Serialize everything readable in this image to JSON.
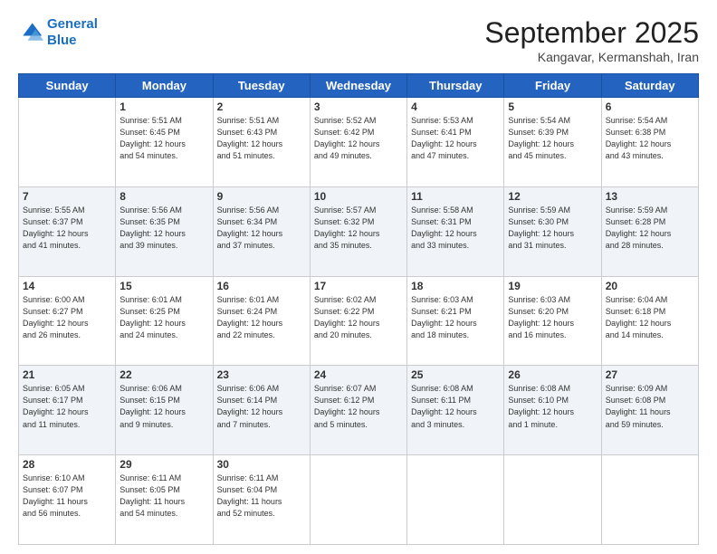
{
  "logo": {
    "line1": "General",
    "line2": "Blue"
  },
  "title": "September 2025",
  "location": "Kangavar, Kermanshah, Iran",
  "days_of_week": [
    "Sunday",
    "Monday",
    "Tuesday",
    "Wednesday",
    "Thursday",
    "Friday",
    "Saturday"
  ],
  "rows": [
    [
      {
        "day": "",
        "text": ""
      },
      {
        "day": "1",
        "text": "Sunrise: 5:51 AM\nSunset: 6:45 PM\nDaylight: 12 hours\nand 54 minutes."
      },
      {
        "day": "2",
        "text": "Sunrise: 5:51 AM\nSunset: 6:43 PM\nDaylight: 12 hours\nand 51 minutes."
      },
      {
        "day": "3",
        "text": "Sunrise: 5:52 AM\nSunset: 6:42 PM\nDaylight: 12 hours\nand 49 minutes."
      },
      {
        "day": "4",
        "text": "Sunrise: 5:53 AM\nSunset: 6:41 PM\nDaylight: 12 hours\nand 47 minutes."
      },
      {
        "day": "5",
        "text": "Sunrise: 5:54 AM\nSunset: 6:39 PM\nDaylight: 12 hours\nand 45 minutes."
      },
      {
        "day": "6",
        "text": "Sunrise: 5:54 AM\nSunset: 6:38 PM\nDaylight: 12 hours\nand 43 minutes."
      }
    ],
    [
      {
        "day": "7",
        "text": "Sunrise: 5:55 AM\nSunset: 6:37 PM\nDaylight: 12 hours\nand 41 minutes."
      },
      {
        "day": "8",
        "text": "Sunrise: 5:56 AM\nSunset: 6:35 PM\nDaylight: 12 hours\nand 39 minutes."
      },
      {
        "day": "9",
        "text": "Sunrise: 5:56 AM\nSunset: 6:34 PM\nDaylight: 12 hours\nand 37 minutes."
      },
      {
        "day": "10",
        "text": "Sunrise: 5:57 AM\nSunset: 6:32 PM\nDaylight: 12 hours\nand 35 minutes."
      },
      {
        "day": "11",
        "text": "Sunrise: 5:58 AM\nSunset: 6:31 PM\nDaylight: 12 hours\nand 33 minutes."
      },
      {
        "day": "12",
        "text": "Sunrise: 5:59 AM\nSunset: 6:30 PM\nDaylight: 12 hours\nand 31 minutes."
      },
      {
        "day": "13",
        "text": "Sunrise: 5:59 AM\nSunset: 6:28 PM\nDaylight: 12 hours\nand 28 minutes."
      }
    ],
    [
      {
        "day": "14",
        "text": "Sunrise: 6:00 AM\nSunset: 6:27 PM\nDaylight: 12 hours\nand 26 minutes."
      },
      {
        "day": "15",
        "text": "Sunrise: 6:01 AM\nSunset: 6:25 PM\nDaylight: 12 hours\nand 24 minutes."
      },
      {
        "day": "16",
        "text": "Sunrise: 6:01 AM\nSunset: 6:24 PM\nDaylight: 12 hours\nand 22 minutes."
      },
      {
        "day": "17",
        "text": "Sunrise: 6:02 AM\nSunset: 6:22 PM\nDaylight: 12 hours\nand 20 minutes."
      },
      {
        "day": "18",
        "text": "Sunrise: 6:03 AM\nSunset: 6:21 PM\nDaylight: 12 hours\nand 18 minutes."
      },
      {
        "day": "19",
        "text": "Sunrise: 6:03 AM\nSunset: 6:20 PM\nDaylight: 12 hours\nand 16 minutes."
      },
      {
        "day": "20",
        "text": "Sunrise: 6:04 AM\nSunset: 6:18 PM\nDaylight: 12 hours\nand 14 minutes."
      }
    ],
    [
      {
        "day": "21",
        "text": "Sunrise: 6:05 AM\nSunset: 6:17 PM\nDaylight: 12 hours\nand 11 minutes."
      },
      {
        "day": "22",
        "text": "Sunrise: 6:06 AM\nSunset: 6:15 PM\nDaylight: 12 hours\nand 9 minutes."
      },
      {
        "day": "23",
        "text": "Sunrise: 6:06 AM\nSunset: 6:14 PM\nDaylight: 12 hours\nand 7 minutes."
      },
      {
        "day": "24",
        "text": "Sunrise: 6:07 AM\nSunset: 6:12 PM\nDaylight: 12 hours\nand 5 minutes."
      },
      {
        "day": "25",
        "text": "Sunrise: 6:08 AM\nSunset: 6:11 PM\nDaylight: 12 hours\nand 3 minutes."
      },
      {
        "day": "26",
        "text": "Sunrise: 6:08 AM\nSunset: 6:10 PM\nDaylight: 12 hours\nand 1 minute."
      },
      {
        "day": "27",
        "text": "Sunrise: 6:09 AM\nSunset: 6:08 PM\nDaylight: 11 hours\nand 59 minutes."
      }
    ],
    [
      {
        "day": "28",
        "text": "Sunrise: 6:10 AM\nSunset: 6:07 PM\nDaylight: 11 hours\nand 56 minutes."
      },
      {
        "day": "29",
        "text": "Sunrise: 6:11 AM\nSunset: 6:05 PM\nDaylight: 11 hours\nand 54 minutes."
      },
      {
        "day": "30",
        "text": "Sunrise: 6:11 AM\nSunset: 6:04 PM\nDaylight: 11 hours\nand 52 minutes."
      },
      {
        "day": "",
        "text": ""
      },
      {
        "day": "",
        "text": ""
      },
      {
        "day": "",
        "text": ""
      },
      {
        "day": "",
        "text": ""
      }
    ]
  ]
}
